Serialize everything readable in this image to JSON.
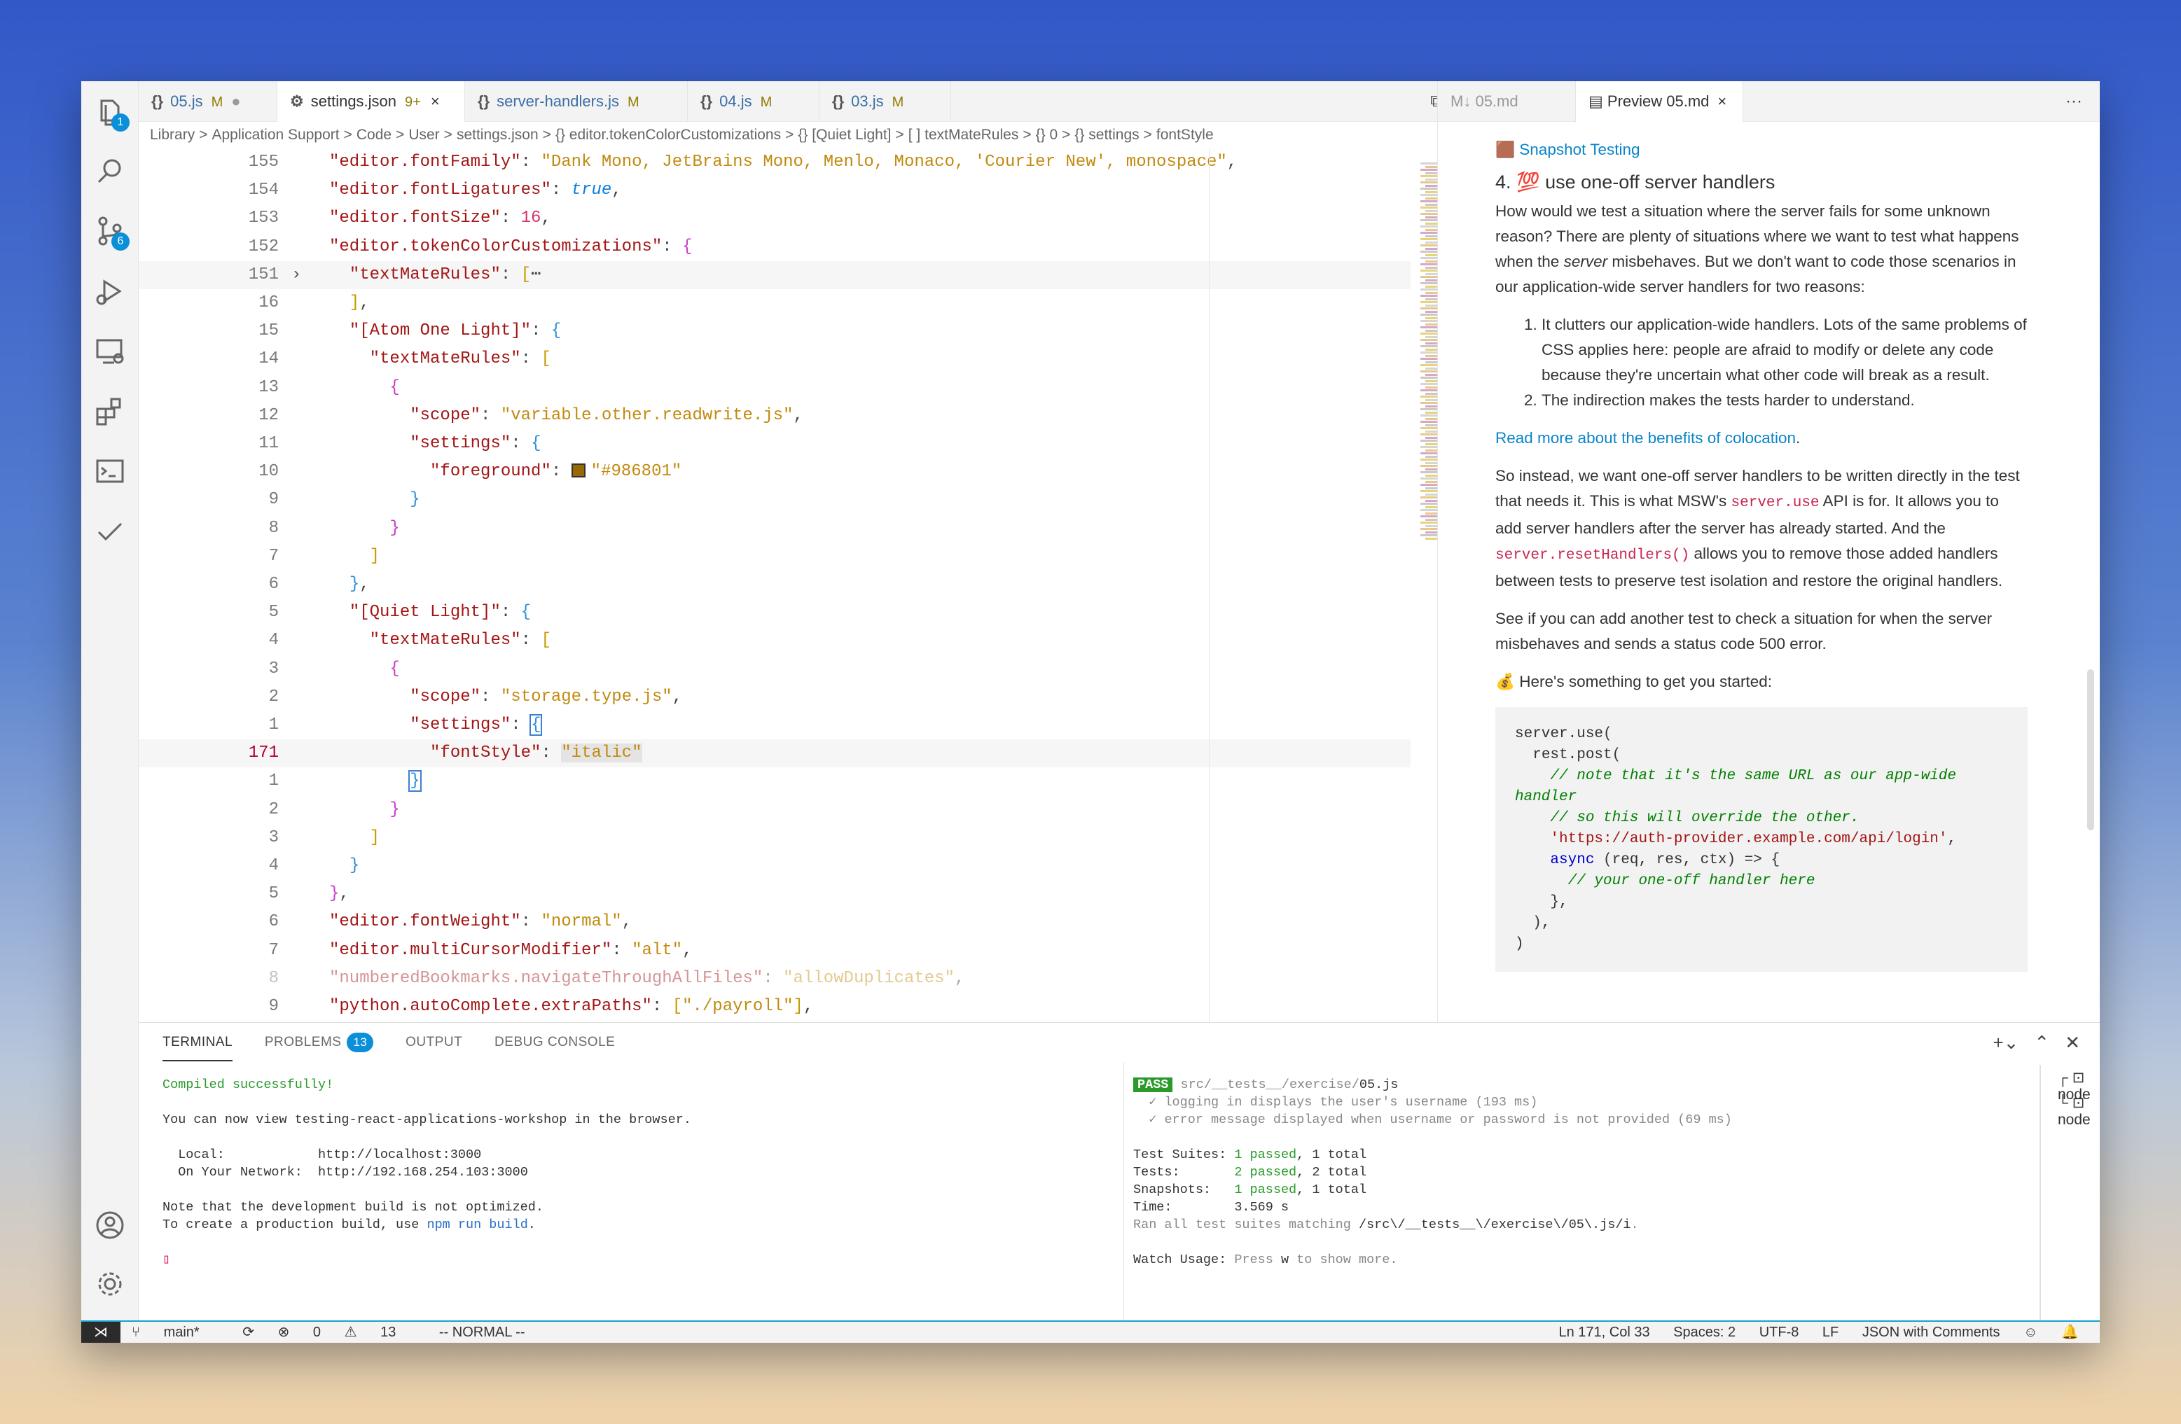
{
  "activity": {
    "explorer_badge": "1",
    "scm_badge": "6"
  },
  "tabs": [
    {
      "icon": "{}",
      "label": "05.js",
      "status": "M",
      "dot": "●"
    },
    {
      "icon": "⚙",
      "label": "settings.json",
      "status": "9+",
      "close": "×"
    },
    {
      "icon": "{}",
      "label": "server-handlers.js",
      "status": "M"
    },
    {
      "icon": "{}",
      "label": "04.js",
      "status": "M"
    },
    {
      "icon": "{}",
      "label": "03.js",
      "status": "M"
    }
  ],
  "breadcrumb": [
    "Library",
    ">",
    "Application Support",
    ">",
    "Code",
    ">",
    "User",
    ">",
    "settings.json",
    ">",
    "{} editor.tokenColorCustomizations",
    ">",
    "{} [Quiet Light]",
    ">",
    "[ ] textMateRules",
    ">",
    "{} 0",
    ">",
    "{} settings",
    ">",
    "fontStyle"
  ],
  "code_lines": [
    {
      "ln": "155",
      "html": "<span class='k'>\"editor.fontFamily\"</span><span class='p'>: </span><span class='s'>\"Dank Mono, JetBrains Mono, Menlo, Monaco, 'Courier New', monospace\"</span><span class='p'>,</span>"
    },
    {
      "ln": "154",
      "html": "<span class='k'>\"editor.fontLigatures\"</span><span class='p'>: </span><span class='b'>true</span><span class='p'>,</span>"
    },
    {
      "ln": "153",
      "html": "<span class='k'>\"editor.fontSize\"</span><span class='p'>: </span><span class='n'>16</span><span class='p'>,</span>"
    },
    {
      "ln": "152",
      "html": "<span class='k'>\"editor.tokenColorCustomizations\"</span><span class='p'>: </span><span class='br1'>{</span>"
    },
    {
      "ln": "151",
      "fold": "›",
      "hl": true,
      "html": "  <span class='k'>\"textMateRules\"</span><span class='p'>: </span><span class='br2'>[</span><span class='p'>⋯</span>"
    },
    {
      "ln": "16",
      "html": "  <span class='br2'>]</span><span class='p'>,</span>"
    },
    {
      "ln": "15",
      "html": "  <span class='k'>\"[Atom One Light]\"</span><span class='p'>: </span><span class='br3'>{</span>"
    },
    {
      "ln": "14",
      "html": "    <span class='k'>\"textMateRules\"</span><span class='p'>: </span><span class='br2'>[</span>"
    },
    {
      "ln": "13",
      "html": "      <span class='br1'>{</span>"
    },
    {
      "ln": "12",
      "html": "        <span class='k'>\"scope\"</span><span class='p'>: </span><span class='s'>\"variable.other.readwrite.js\"</span><span class='p'>,</span>"
    },
    {
      "ln": "11",
      "html": "        <span class='k'>\"settings\"</span><span class='p'>: </span><span class='br3'>{</span>"
    },
    {
      "ln": "10",
      "html": "          <span class='k'>\"foreground\"</span><span class='p'>: </span><span class='swatch'></span><span class='s'>\"#986801\"</span>"
    },
    {
      "ln": "9",
      "html": "        <span class='br3'>}</span>"
    },
    {
      "ln": "8",
      "html": "      <span class='br1'>}</span>"
    },
    {
      "ln": "7",
      "html": "    <span class='br2'>]</span>"
    },
    {
      "ln": "6",
      "html": "  <span class='br3'>}</span><span class='p'>,</span>"
    },
    {
      "ln": "5",
      "html": "  <span class='k'>\"[Quiet Light]\"</span><span class='p'>: </span><span class='br3'>{</span>"
    },
    {
      "ln": "4",
      "html": "    <span class='k'>\"textMateRules\"</span><span class='p'>: </span><span class='br2'>[</span>"
    },
    {
      "ln": "3",
      "html": "      <span class='br1'>{</span>"
    },
    {
      "ln": "2",
      "html": "        <span class='k'>\"scope\"</span><span class='p'>: </span><span class='s'>\"storage.type.js\"</span><span class='p'>,</span>"
    },
    {
      "ln": "1",
      "html": "        <span class='k'>\"settings\"</span><span class='p'>: </span><span class='br3 cursorbox'>{</span>"
    },
    {
      "ln": "171",
      "cur": true,
      "hl": true,
      "html": "          <span class='k'>\"fontStyle\"</span><span class='p'>: </span><span class='s selword'>\"italic\"</span>"
    },
    {
      "ln": "1",
      "html": "        <span class='br3 cursorbox'>}</span>"
    },
    {
      "ln": "2",
      "html": "      <span class='br1'>}</span>"
    },
    {
      "ln": "3",
      "html": "    <span class='br2'>]</span>"
    },
    {
      "ln": "4",
      "html": "  <span class='br3'>}</span>"
    },
    {
      "ln": "5",
      "html": "<span class='br1'>}</span><span class='p'>,</span>"
    },
    {
      "ln": "6",
      "html": "<span class='k'>\"editor.fontWeight\"</span><span class='p'>: </span><span class='s'>\"normal\"</span><span class='p'>,</span>"
    },
    {
      "ln": "7",
      "html": "<span class='k'>\"editor.multiCursorModifier\"</span><span class='p'>: </span><span class='s'>\"alt\"</span><span class='p'>,</span>"
    },
    {
      "ln": "8",
      "faded": true,
      "html": "<span class='k'>\"numberedBookmarks.navigateThroughAllFiles\"</span><span class='p'>: </span><span class='s'>\"allowDuplicates\"</span><span class='p'>,</span>"
    },
    {
      "ln": "9",
      "html": "<span class='k'>\"python.autoComplete.extraPaths\"</span><span class='p'>: </span><span class='br2'>[</span><span class='s'>\"./payroll\"</span><span class='br2'>]</span><span class='p'>,</span>"
    }
  ],
  "preview_tabs": {
    "source": "05.md",
    "preview": "Preview 05.md",
    "close": "×",
    "more": "···"
  },
  "preview": {
    "snapshot_link": "Snapshot Testing",
    "heading": "4. 💯 use one-off server handlers",
    "p1_a": "How would we test a situation where the server fails for some unknown reason? There are plenty of situations where we want to test what happens when the ",
    "p1_em": "server",
    "p1_b": " misbehaves. But we don't want to code those scenarios in our application-wide server handlers for two reasons:",
    "li1": "It clutters our application-wide handlers. Lots of the same problems of CSS applies here: people are afraid to modify or delete any code because they're uncertain what other code will break as a result.",
    "li2": "The indirection makes the tests harder to understand.",
    "colocation_link": "Read more about the benefits of colocation",
    "colocation_dot": ".",
    "p3_a": "So instead, we want one-off server handlers to be written directly in the test that needs it. This is what MSW's ",
    "p3_code1": "server.use",
    "p3_b": " API is for. It allows you to add server handlers after the server has already started. And the ",
    "p3_code2": "server.resetHandlers()",
    "p3_c": " allows you to remove those added handlers between tests to preserve test isolation and restore the original handlers.",
    "p4": "See if you can add another test to check a situation for when the server misbehaves and sends a status code 500 error.",
    "p5": "💰 Here's something to get you started:",
    "code_1": "server.use(\n  rest.post(\n    ",
    "code_c1": "// note that it's the same URL as our app-wide handler",
    "code_2": "\n    ",
    "code_c2": "// so this will override the other.",
    "code_3": "\n    ",
    "code_str": "'https://auth-provider.example.com/api/login'",
    "code_4": ",\n    ",
    "code_kw": "async",
    "code_5": " (req, res, ctx) => {\n      ",
    "code_c3": "// your one-off handler here",
    "code_6": "\n    },\n  ),\n)"
  },
  "panel": {
    "tabs": [
      "TERMINAL",
      "PROBLEMS",
      "OUTPUT",
      "DEBUG CONSOLE"
    ],
    "problems_count": "13",
    "terminal_left": {
      "compiled": "Compiled successfully!",
      "view": "You can now view testing-react-applications-workshop in the browser.",
      "local_label": "  Local:            ",
      "local_url": "http://localhost:3000",
      "network_label": "  On Your Network:  ",
      "network_url": "http://192.168.254.103:3000",
      "note1": "Note that the development build is not optimized.",
      "note2_a": "To create a production build, use ",
      "note2_cmd": "npm run build",
      "note2_b": "."
    },
    "terminal_right": {
      "pass": "PASS",
      "path_a": " src/__tests__/exercise/",
      "path_b": "05.js",
      "t1": "  ✓ logging in displays the user's username (193 ms)",
      "t2": "  ✓ error message displayed when username or password is not provided (69 ms)",
      "suites_label": "Test Suites: ",
      "suites_pass": "1 passed",
      "suites_total": ", 1 total",
      "tests_label": "Tests:       ",
      "tests_pass": "2 passed",
      "tests_total": ", 2 total",
      "snap_label": "Snapshots:   ",
      "snap_pass": "1 passed",
      "snap_total": ", 1 total",
      "time": "Time:        3.569 s",
      "ran_a": "Ran all test suites matching ",
      "ran_b": "/src\\/__tests__\\/exercise\\/05\\.js/i",
      "ran_c": ".",
      "watch_a": "Watch Usage: ",
      "watch_b": "Press ",
      "watch_key": "w",
      "watch_c": " to show more."
    },
    "terminal_list": [
      "node",
      "node"
    ]
  },
  "status": {
    "branch": "main*",
    "errors": "0",
    "warnings": "13",
    "mode": "-- NORMAL --",
    "position": "Ln 171, Col 33",
    "spaces": "Spaces: 2",
    "encoding": "UTF-8",
    "eol": "LF",
    "language": "JSON with Comments"
  }
}
